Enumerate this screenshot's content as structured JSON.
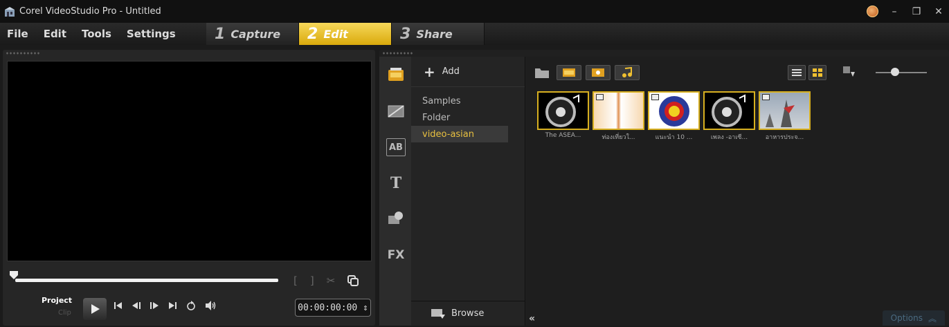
{
  "titlebar": {
    "title": "Corel VideoStudio Pro - Untitled",
    "controls": {
      "minimize": "–",
      "restore": "❐",
      "close": "✕"
    }
  },
  "menu": [
    "File",
    "Edit",
    "Tools",
    "Settings"
  ],
  "steps": [
    {
      "num": "1",
      "label": "Capture",
      "active": false
    },
    {
      "num": "2",
      "label": "Edit",
      "active": true
    },
    {
      "num": "3",
      "label": "Share",
      "active": false
    }
  ],
  "preview": {
    "trim_in": "[",
    "trim_out": "]",
    "scissors": "✂",
    "project_label": "Project",
    "clip_label": "Clip",
    "timecode": "00:00:00:00 ⇕"
  },
  "library": {
    "add_label": "Add",
    "folders": [
      {
        "label": "Samples",
        "selected": false
      },
      {
        "label": "Folder",
        "selected": false
      },
      {
        "label": "video-asian",
        "selected": true
      }
    ],
    "browse_label": "Browse",
    "tab_icons": [
      "media-icon",
      "transition-icon",
      "title-ab-icon",
      "text-t-icon",
      "graphic-icon",
      "fx-icon"
    ],
    "fx_label": "FX",
    "ab_label": "AB",
    "t_label": "T",
    "options_label": "Options",
    "collapse_label": "«",
    "thumbnails": [
      {
        "label": "The ASEA...",
        "type": "audio"
      },
      {
        "label": "ท่องเที่ยวใ...",
        "type": "video"
      },
      {
        "label": "แนะนำ 10 ...",
        "type": "video"
      },
      {
        "label": "เพลง -อาเซี...",
        "type": "audio"
      },
      {
        "label": "อาหารประจ...",
        "type": "video"
      }
    ]
  },
  "colors": {
    "accent": "#e8c040",
    "active_step": "#f0c830",
    "thumb_border": "#d8b020"
  }
}
